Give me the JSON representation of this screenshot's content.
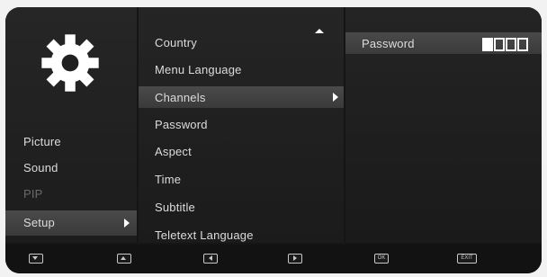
{
  "left_menu": {
    "items": [
      {
        "label": "Picture",
        "enabled": true
      },
      {
        "label": "Sound",
        "enabled": true
      },
      {
        "label": "PIP",
        "enabled": false
      },
      {
        "label": "Setup",
        "enabled": true,
        "selected": true
      }
    ]
  },
  "setup_menu": {
    "items": [
      {
        "label": "Country"
      },
      {
        "label": "Menu Language"
      },
      {
        "label": "Channels",
        "selected": true
      },
      {
        "label": "Password"
      },
      {
        "label": "Aspect"
      },
      {
        "label": "Time"
      },
      {
        "label": "Subtitle"
      },
      {
        "label": "Teletext Language"
      }
    ]
  },
  "channels_panel": {
    "password_label": "Password",
    "password_digits_entered": 1,
    "password_length": 4
  },
  "bottom_bar": {
    "buttons": [
      {
        "icon": "down-arrow-icon"
      },
      {
        "icon": "up-arrow-icon"
      },
      {
        "icon": "left-arrow-icon"
      },
      {
        "icon": "right-arrow-icon"
      },
      {
        "label": "OK"
      },
      {
        "label": "EXIT"
      }
    ]
  },
  "colors": {
    "background": "#151515",
    "selection": "#444444",
    "text": "#dcdcdc",
    "disabled_text": "#6a6a6a"
  }
}
